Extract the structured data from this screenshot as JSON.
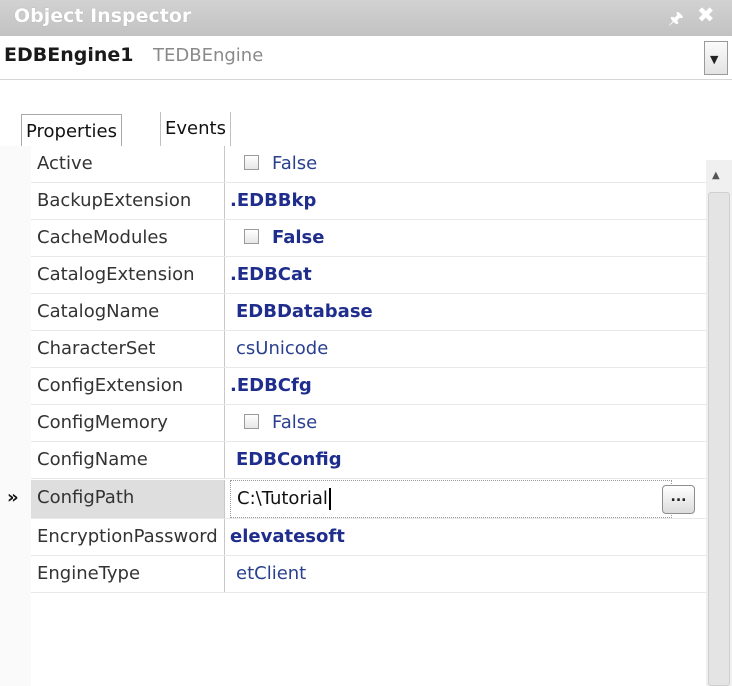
{
  "window": {
    "title": "Object Inspector",
    "pin_icon": "pin-icon",
    "close_icon": "close-icon"
  },
  "object_selector": {
    "name": "EDBEngine1",
    "type": "TEDBEngine"
  },
  "tabs": [
    {
      "label": "Properties"
    },
    {
      "label": "Events"
    }
  ],
  "properties": [
    {
      "name": "Active",
      "value": "False"
    },
    {
      "name": "BackupExtension",
      "value": ".EDBBkp"
    },
    {
      "name": "CacheModules",
      "value": "False"
    },
    {
      "name": "CatalogExtension",
      "value": ".EDBCat"
    },
    {
      "name": "CatalogName",
      "value": "EDBDatabase"
    },
    {
      "name": "CharacterSet",
      "value": "csUnicode"
    },
    {
      "name": "ConfigExtension",
      "value": ".EDBCfg"
    },
    {
      "name": "ConfigMemory",
      "value": "False"
    },
    {
      "name": "ConfigName",
      "value": "EDBConfig"
    },
    {
      "name": "ConfigPath",
      "value": "C:\\Tutorial"
    },
    {
      "name": "EncryptionPassword",
      "value": "elevatesoft"
    },
    {
      "name": "EngineType",
      "value": "etClient"
    }
  ],
  "selected_marker": "»",
  "ellipsis_label": "...",
  "colors": {
    "value_text": "#2a3f8f",
    "title_bar": "#c8c8c8"
  }
}
